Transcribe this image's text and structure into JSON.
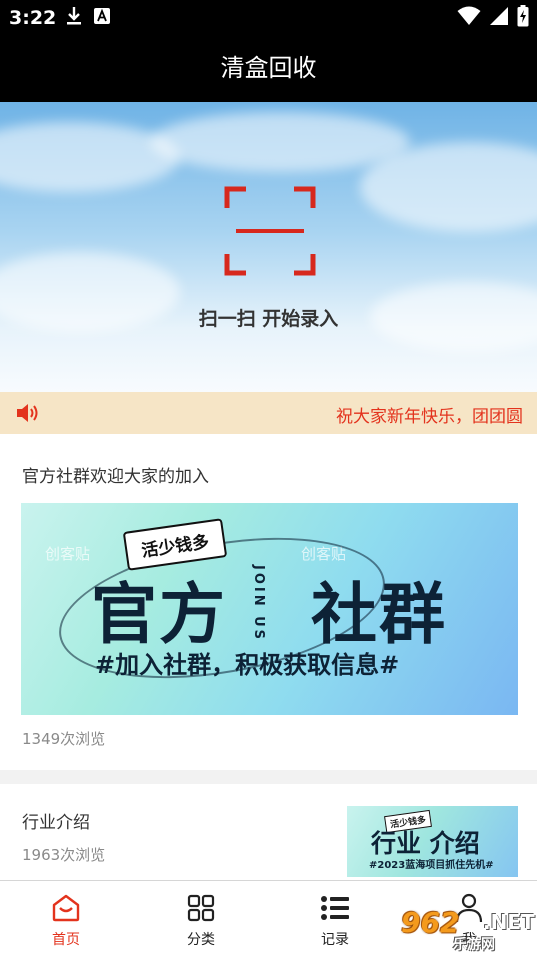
{
  "status_bar": {
    "time": "3:22",
    "icons_left": [
      "download-icon",
      "a-app-icon"
    ],
    "icons_right": [
      "wifi-icon",
      "signal-icon",
      "battery-charging-icon"
    ]
  },
  "header": {
    "title": "清盒回收"
  },
  "hero": {
    "scan_label": "扫一扫 开始录入",
    "scan_icon": "scan-frame-icon",
    "accent_color": "#d7281d"
  },
  "notice": {
    "icon": "speaker-icon",
    "text": "祝大家新年快乐，团团圆",
    "color": "#e3331d"
  },
  "articles": [
    {
      "title": "官方社群欢迎大家的加入",
      "views": "1349次浏览",
      "banner": {
        "tag": "活少钱多",
        "title_left": "官方",
        "title_right": "社群",
        "join_text": "JOIN US",
        "subtitle": "#加入社群，积极获取信息#",
        "watermark": "创客贴"
      }
    },
    {
      "title": "行业介绍",
      "views": "1963次浏览",
      "banner": {
        "tag": "活少钱多",
        "title": "行业 介绍",
        "subtitle": "#2023蓝海项目抓住先机#"
      }
    }
  ],
  "tabbar": {
    "active_color": "#e3331d",
    "tabs": [
      {
        "label": "首页",
        "icon": "home-icon",
        "active": true
      },
      {
        "label": "分类",
        "icon": "grid-icon",
        "active": false
      },
      {
        "label": "记录",
        "icon": "list-icon",
        "active": false
      },
      {
        "label": "我",
        "icon": "profile-icon",
        "active": false
      }
    ]
  },
  "watermark_brand": {
    "number": "962",
    "domain": ".NET",
    "text": "乐游网"
  }
}
